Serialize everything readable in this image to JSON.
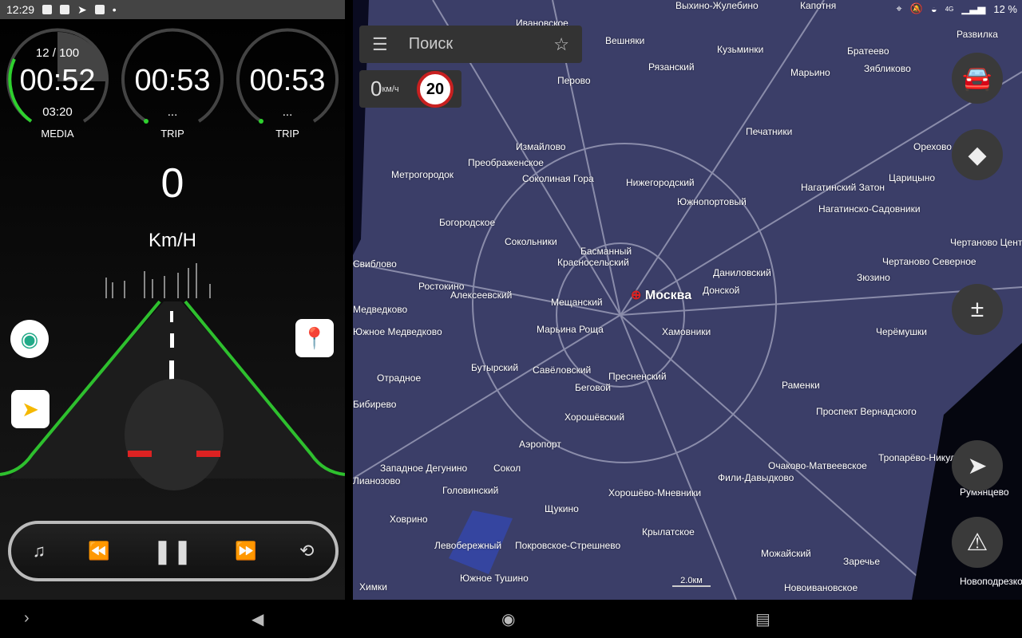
{
  "status_bar": {
    "time": "12:29",
    "battery": "12 %",
    "network": "4G",
    "icons": [
      "battery-icon",
      "image-icon",
      "telegram-icon",
      "app-icon",
      "dot-icon"
    ],
    "right_icons": [
      "location-icon",
      "bell-off-icon",
      "wifi-icon",
      "signal-icon"
    ]
  },
  "gauges": [
    {
      "top": "12 / 100",
      "time": "00:52",
      "sub": "03:20",
      "label": "MEDIA",
      "progress": 0.26
    },
    {
      "time": "00:53",
      "sub": "...",
      "label": "TRIP",
      "progress": 0
    },
    {
      "time": "00:53",
      "sub": "...",
      "label": "TRIP",
      "progress": 0
    }
  ],
  "speed": {
    "value": "0",
    "unit": "Km/H"
  },
  "player": {
    "icons": [
      "music-note-icon",
      "rewind-icon",
      "pause-icon",
      "fast-forward-icon",
      "repeat-icon"
    ]
  },
  "map": {
    "search_placeholder": "Поиск",
    "speed_value": "0",
    "speed_unit": "км/ч",
    "speed_limit": "20",
    "scale": "2.0км",
    "city": "Москва",
    "labels": [
      "Вешняки",
      "Рязанский",
      "Кузьминки",
      "Братеево",
      "Зябликово",
      "Развилка",
      "Перово",
      "Марьино",
      "Печатники",
      "Измайлово",
      "Преображенское",
      "Метрогородок",
      "Соколиная Гора",
      "Нижегородский",
      "Южнопортовый",
      "Нагатинский Затон",
      "Царицыно",
      "Нагатинско-Садовники",
      "Богородское",
      "Сокольники",
      "Басманный",
      "Красносельский",
      "Даниловский",
      "Донской",
      "Чертаново Северное",
      "Ростокино",
      "Алексеевский",
      "Мещанский",
      "Марьина Роща",
      "Хамовники",
      "Зюзино",
      "Черёмушки",
      "Отрадное",
      "Бутырский",
      "Савёловский",
      "Беговой",
      "Пресненский",
      "Раменки",
      "Хорошёвский",
      "Проспект Вернадского",
      "Аэропорт",
      "Западное Дегунино",
      "Сокол",
      "Головинский",
      "Очаково-Матвеевское",
      "Тропарёво-Никулино",
      "Фили-Давыдково",
      "Хорошёво-Мневники",
      "Щукино",
      "Ховрино",
      "Крылатское",
      "Левобережный",
      "Покровское-Стрешнево",
      "Можайский",
      "Заречье",
      "Южное Тушино",
      "Новоивановское",
      "Химки",
      "Орехово",
      "Чертаново Центр",
      "Ивановское",
      "Выхино-Жулебино",
      "Капотня",
      "Румянцево",
      "Новоподрезково",
      "Медведково",
      "Южное Медведково",
      "Свиблово",
      "Бибирево",
      "Лианозово"
    ],
    "buttons": [
      "traffic-button",
      "compass-button",
      "zoom-button",
      "my-location-button",
      "report-button"
    ]
  },
  "colors": {
    "accent_green": "#2ed12e",
    "map_bg": "#3b3e68",
    "limit_red": "#c82020"
  }
}
